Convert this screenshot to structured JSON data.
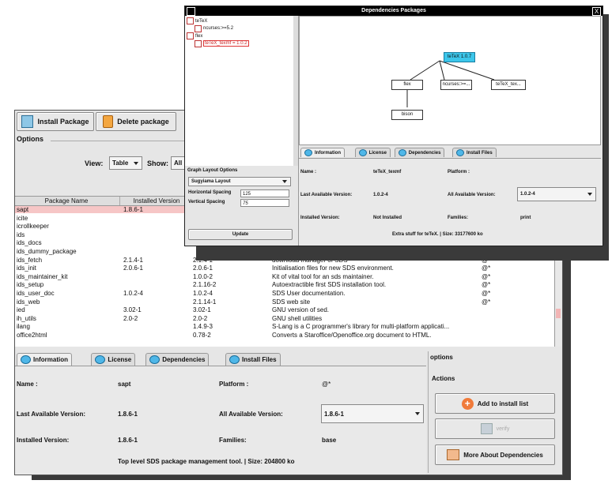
{
  "main": {
    "toolbar": {
      "install_label": "Install Package",
      "delete_label": "Delete package"
    },
    "options_title": "Options",
    "view_label": "View:",
    "view_value": "Table",
    "show_label": "Show:",
    "show_value": "All",
    "table": {
      "headers": [
        "Package Name",
        "Installed Version"
      ],
      "rows": [
        {
          "name": "sapt",
          "installed": "1.8.6-1",
          "version": "",
          "desc": "",
          "flag": "",
          "selected": true
        },
        {
          "name": "icite",
          "installed": "",
          "version": "",
          "desc": "",
          "flag": "",
          "selected": false
        },
        {
          "name": "icrollkeeper",
          "installed": "",
          "version": "",
          "desc": "",
          "flag": "",
          "selected": false
        },
        {
          "name": "ids",
          "installed": "",
          "version": "",
          "desc": "",
          "flag": "",
          "selected": false
        },
        {
          "name": "ids_docs",
          "installed": "",
          "version": "",
          "desc": "",
          "flag": "",
          "selected": false
        },
        {
          "name": "ids_dummy_package",
          "installed": "",
          "version": "",
          "desc": "",
          "flag": "",
          "selected": false
        },
        {
          "name": "ids_fetch",
          "installed": "2.1.4-1",
          "version": "2.1.4-1",
          "desc": "download manager of SDS",
          "flag": "@*",
          "selected": false
        },
        {
          "name": "ids_init",
          "installed": "2.0.6-1",
          "version": "2.0.6-1",
          "desc": "Initialisation files for new SDS environment.",
          "flag": "@*",
          "selected": false
        },
        {
          "name": "ids_maintainer_kit",
          "installed": "",
          "version": "1.0.0-2",
          "desc": "Kit of vital tool for an sds maintainer.",
          "flag": "@*",
          "selected": false
        },
        {
          "name": "ids_setup",
          "installed": "",
          "version": "2.1.16-2",
          "desc": "Autoextractible first SDS installation tool.",
          "flag": "@*",
          "selected": false
        },
        {
          "name": "ids_user_doc",
          "installed": "1.0.2-4",
          "version": "1.0.2-4",
          "desc": "SDS User documentation.",
          "flag": "@*",
          "selected": false
        },
        {
          "name": "ids_web",
          "installed": "",
          "version": "2.1.14-1",
          "desc": "SDS web site",
          "flag": "@*",
          "selected": false
        },
        {
          "name": "ied",
          "installed": "3.02-1",
          "version": "3.02-1",
          "desc": "GNU version of sed.",
          "flag": "",
          "selected": false
        },
        {
          "name": "ih_utils",
          "installed": "2.0-2",
          "version": "2.0-2",
          "desc": "GNU shell utilities",
          "flag": "",
          "selected": false
        },
        {
          "name": "ilang",
          "installed": "",
          "version": "1.4.9-3",
          "desc": "S-Lang is a C programmer's library for multi-platform applicati...",
          "flag": "",
          "selected": false
        },
        {
          "name": "office2html",
          "installed": "",
          "version": "0.78-2",
          "desc": "Converts a Staroffice/Openoffice.org document to HTML.",
          "flag": "",
          "selected": false
        }
      ]
    },
    "tabs": [
      "Information",
      "License",
      "Dependencies",
      "Install Files"
    ],
    "info": {
      "name_label": "Name :",
      "name_value": "sapt",
      "platform_label": "Platform :",
      "platform_value": "@*",
      "last_label": "Last Available  Version:",
      "last_value": "1.8.6-1",
      "all_label": "All Available Version:",
      "all_value": "1.8.6-1",
      "installed_label": "Installed Version:",
      "installed_value": "1.8.6-1",
      "families_label": "Families:",
      "families_value": "base",
      "summary": "Top level SDS package management tool.  |  Size:  204800  ko"
    },
    "options_panel": {
      "title": "options",
      "actions_title": "Actions",
      "add_label": "Add to install list",
      "verify_label": "verify",
      "more_label": "More About Dependencies"
    }
  },
  "deps": {
    "title": "Dependencies Packages",
    "close": "X",
    "tree": [
      {
        "label": "teTeX",
        "indent": 0,
        "highlight": false
      },
      {
        "label": "ncurses:>=5.2",
        "indent": 1,
        "highlight": false
      },
      {
        "label": "flex",
        "indent": 0,
        "highlight": false
      },
      {
        "label": "teTeX_texmf = 1.0.2",
        "indent": 1,
        "highlight": true
      }
    ],
    "layout": {
      "title": "Graph Layout Options",
      "algorithm": "Sugyiama Layout",
      "hspacing_label": "Horizontal Spacing",
      "hspacing_value": "125",
      "vspacing_label": "Vertical Spacing",
      "vspacing_value": "75",
      "update_label": "Update"
    },
    "graph": {
      "root": "teTeX 1.0.7",
      "children": [
        "flex",
        "ncurses:>=...",
        "teTeX_tex..."
      ],
      "grandchild": "bison"
    },
    "tabs": [
      "Information",
      "License",
      "Dependencies",
      "Install Files"
    ],
    "info": {
      "name_label": "Name :",
      "name_value": "teTeX_texmf",
      "platform_label": "Platform :",
      "platform_value": "",
      "last_label": "Last Available  Version:",
      "last_value": "1.0.2-4",
      "all_label": "All Available Version:",
      "all_value": "1.0.2-4",
      "installed_label": "Installed Version:",
      "installed_value": "Not Installed",
      "families_label": "Families:",
      "families_value": "print",
      "summary": "Extra stuff for teTeX.  |  Size:  33177600  ko"
    }
  },
  "colors": {
    "accent_blue": "#4fb7e8",
    "selected_row": "#f6c6c6",
    "graph_root": "#3cc6ea"
  }
}
